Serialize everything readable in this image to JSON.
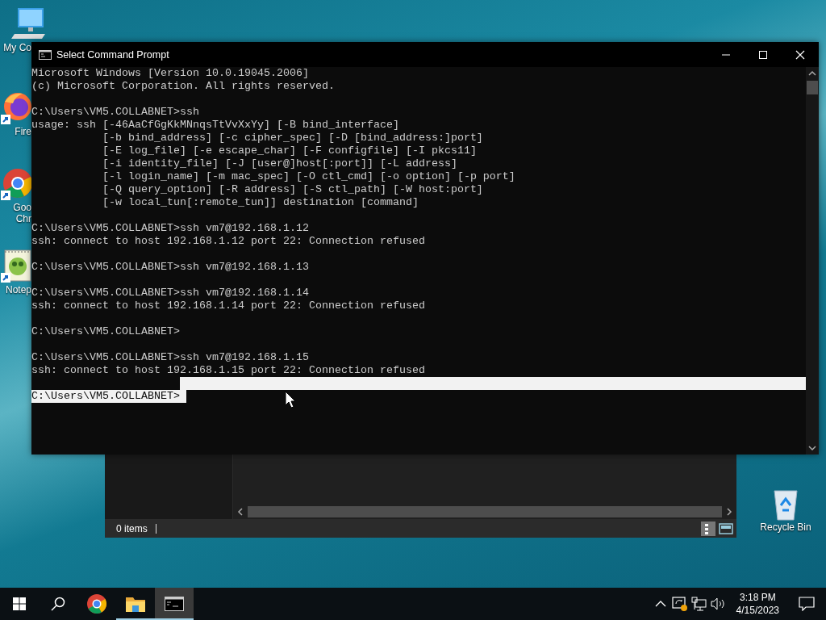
{
  "desktop_icons": [
    {
      "kind": "computer",
      "lines": [
        "My Co"
      ],
      "shortcut": false
    },
    {
      "kind": "firefox",
      "lines": [
        "Fire"
      ],
      "shortcut": true
    },
    {
      "kind": "chrome",
      "lines": [
        "Goo",
        "Chr"
      ],
      "shortcut": true
    },
    {
      "kind": "notepad",
      "lines": [
        "Notep"
      ],
      "shortcut": true
    },
    {
      "kind": "recycle",
      "lines": [
        "Recycle Bin"
      ],
      "shortcut": false
    }
  ],
  "explorer": {
    "status": "0 items"
  },
  "console": {
    "title": "Select Command Prompt",
    "lines": [
      {
        "text": "Microsoft Windows [Version 10.0.19045.2006]",
        "selected": false
      },
      {
        "text": "(c) Microsoft Corporation. All rights reserved.",
        "selected": false
      },
      {
        "selected": false
      },
      {
        "text": "C:\\Users\\VM5.COLLABNET>ssh",
        "selected": false
      },
      {
        "text": "usage: ssh [-46AaCfGgKkMNnqsTtVvXxYy] [-B bind_interface]",
        "selected": false
      },
      {
        "text": "           [-b bind_address] [-c cipher_spec] [-D [bind_address:]port]",
        "selected": false
      },
      {
        "text": "           [-E log_file] [-e escape_char] [-F configfile] [-I pkcs11]",
        "selected": false
      },
      {
        "text": "           [-i identity_file] [-J [user@]host[:port]] [-L address]",
        "selected": false
      },
      {
        "text": "           [-l login_name] [-m mac_spec] [-O ctl_cmd] [-o option] [-p port]",
        "selected": false
      },
      {
        "text": "           [-Q query_option] [-R address] [-S ctl_path] [-W host:port]",
        "selected": false
      },
      {
        "text": "           [-w local_tun[:remote_tun]] destination [command]",
        "selected": false
      },
      {
        "selected": false
      },
      {
        "text": "C:\\Users\\VM5.COLLABNET>ssh vm7@192.168.1.12",
        "selected": false
      },
      {
        "text": "ssh: connect to host 192.168.1.12 port 22: Connection refused",
        "selected": false
      },
      {
        "selected": false
      },
      {
        "text": "C:\\Users\\VM5.COLLABNET>ssh vm7@192.168.1.13",
        "selected": false
      },
      {
        "selected": false
      },
      {
        "text": "C:\\Users\\VM5.COLLABNET>ssh vm7@192.168.1.14",
        "selected": false
      },
      {
        "text": "ssh: connect to host 192.168.1.14 port 22: Connection refused",
        "selected": false
      },
      {
        "selected": false
      },
      {
        "text": "C:\\Users\\VM5.COLLABNET>",
        "selected": false
      },
      {
        "selected": false
      },
      {
        "text": "C:\\Users\\VM5.COLLABNET>ssh vm7@192.168.1.15",
        "selected": false
      },
      {
        "text": "ssh: connect to host 192.168.1.15 port 22: Connection refused",
        "selected": false
      },
      {
        "selected": true
      },
      {
        "text": "C:\\Users\\VM5.COLLABNET> ",
        "selected": true
      }
    ]
  },
  "taskbar": {
    "items": [
      {
        "kind": "start",
        "running": false,
        "active": false
      },
      {
        "kind": "search",
        "running": false,
        "active": false
      },
      {
        "kind": "chrome",
        "running": false,
        "active": false
      },
      {
        "kind": "folder",
        "running": true,
        "active": false
      },
      {
        "kind": "console",
        "running": true,
        "active": true
      }
    ],
    "tray": [
      {
        "kind": "chevron"
      },
      {
        "kind": "sync"
      },
      {
        "kind": "network"
      },
      {
        "kind": "volume"
      }
    ],
    "time": "3:18 PM",
    "date": "4/15/2023"
  }
}
